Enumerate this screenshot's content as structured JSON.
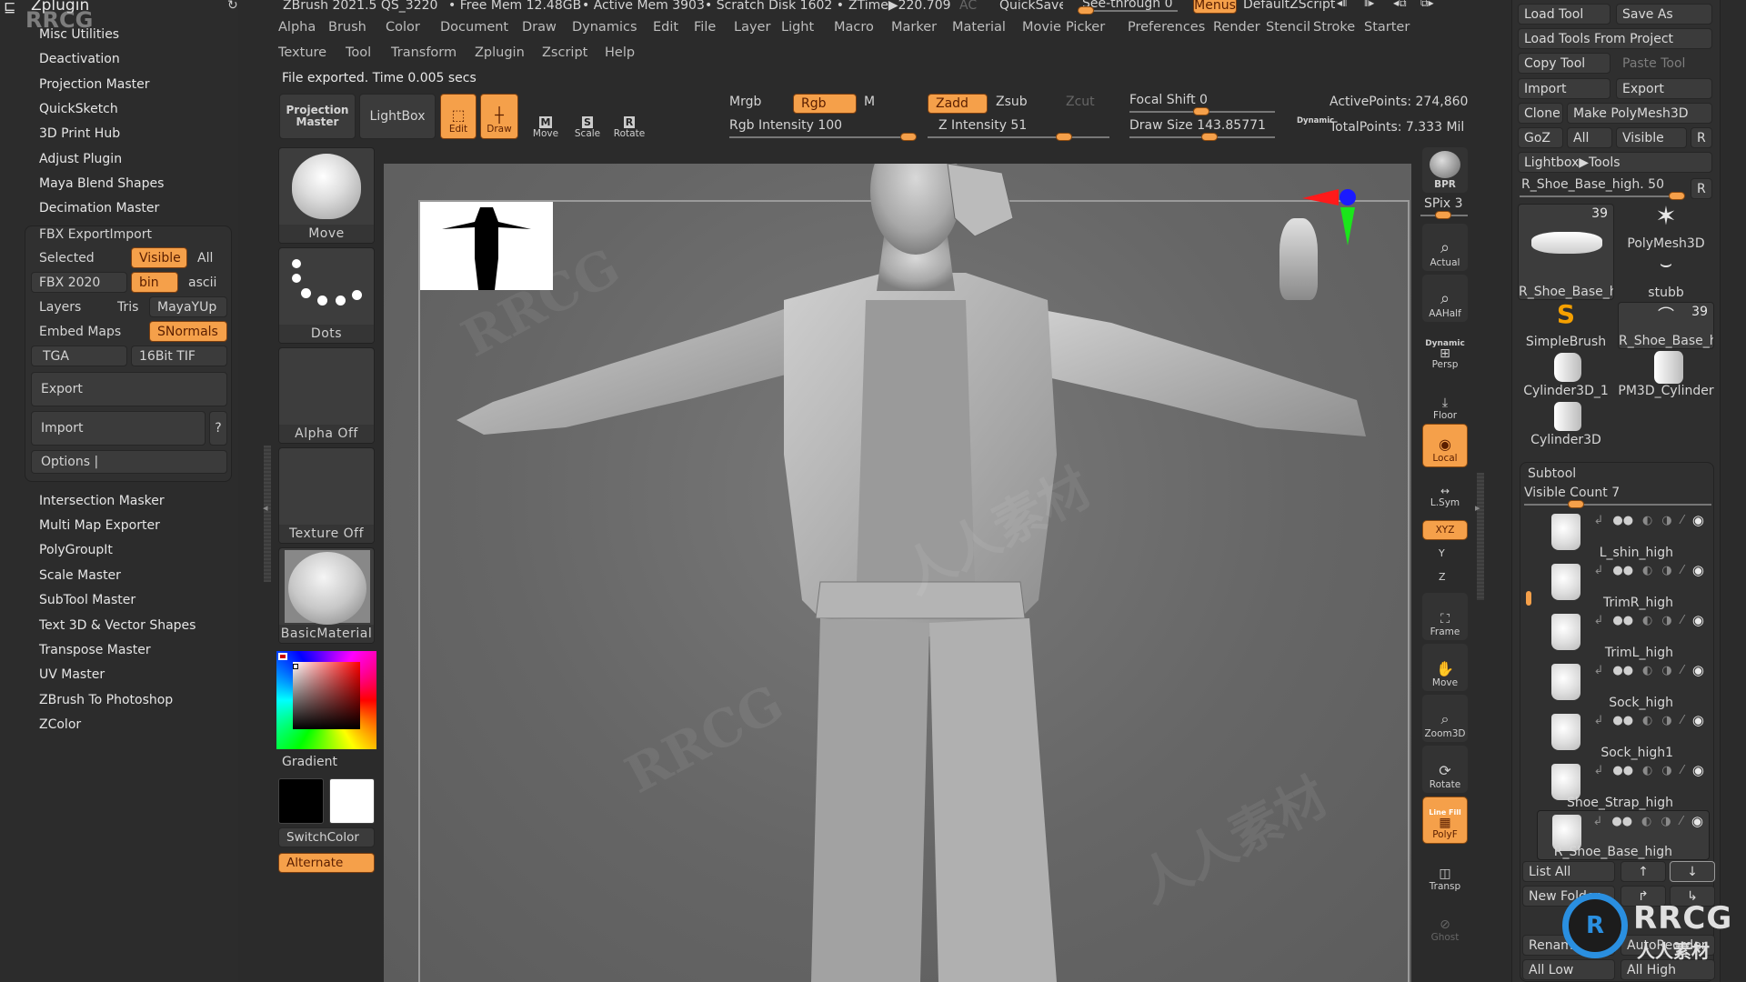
{
  "title_bar": {
    "app_info": "ZBrush 2021.5 QS_3220",
    "free_mem": "• Free Mem 12.48GB",
    "active_mem": "• Active Mem 3903",
    "scratch_disk": "• Scratch Disk 1602 •",
    "ztime": "ZTime▶220.709",
    "ac": "AC",
    "quicksave": "QuickSave",
    "see_through": "See-through  0",
    "see_through_value": 0,
    "menus": "Menus",
    "default_zscript": "DefaultZScript"
  },
  "menu_bar": {
    "row1": [
      "Alpha",
      "Brush",
      "Color",
      "Document",
      "Draw",
      "Dynamics",
      "Edit",
      "File",
      "Layer",
      "Light",
      "Macro",
      "Marker",
      "Material",
      "Movie",
      "Picker",
      "Preferences",
      "Render",
      "Stencil",
      "Stroke",
      "Starter"
    ],
    "row2": [
      "Texture",
      "Tool",
      "Transform",
      "Zplugin",
      "Zscript",
      "Help"
    ]
  },
  "status_message": "File exported. Time 0.005 secs",
  "zplugin": {
    "header": "Zplugin",
    "items_top": [
      "Misc Utilities",
      "Deactivation",
      "Projection Master",
      "QuickSketch",
      "3D Print Hub",
      "Adjust Plugin",
      "Maya Blend Shapes",
      "Decimation Master"
    ],
    "fbx": {
      "title": "FBX ExportImport",
      "selected": "Selected",
      "visible": "Visible",
      "all": "All",
      "fbx_version": "FBX 2020",
      "bin": "bin",
      "ascii": "ascii",
      "layers": "Layers",
      "tris": "Tris",
      "mayayup": "MayaYUp",
      "embed_maps": "Embed Maps",
      "snormals": "SNormals",
      "tga": "TGA",
      "tif": "16Bit TIF",
      "export": "Export",
      "import": "Import",
      "help": "?",
      "options": "Options |"
    },
    "items_bottom": [
      "Intersection Masker",
      "Multi Map Exporter",
      "PolyGroupIt",
      "Scale Master",
      "SubTool Master",
      "Text 3D & Vector Shapes",
      "Transpose Master",
      "UV Master",
      "ZBrush To Photoshop",
      "ZColor"
    ]
  },
  "toolbar": {
    "projection_master": "Projection Master",
    "lightbox": "LightBox",
    "edit": "Edit",
    "draw": "Draw",
    "move": "Move",
    "scale": "Scale",
    "rotate": "Rotate",
    "mrgb": "Mrgb",
    "rgb": "Rgb",
    "m": "M",
    "rgb_intensity": "Rgb Intensity 100",
    "rgb_intensity_value": 100,
    "zadd": "Zadd",
    "zsub": "Zsub",
    "zcut": "Zcut",
    "z_intensity": "Z Intensity 51",
    "z_intensity_value": 51,
    "focal_shift": "Focal Shift 0",
    "focal_shift_value": 0,
    "draw_size": "Draw Size 143.85771",
    "draw_size_value": 143.85771,
    "dynamic": "Dynamic",
    "active_points": "ActivePoints: 274,860",
    "total_points": "TotalPoints: 7.333 Mil"
  },
  "palette": {
    "brush": "Move",
    "stroke": "Dots",
    "alpha": "Alpha Off",
    "texture": "Texture Off",
    "material": "BasicMaterial",
    "gradient": "Gradient",
    "switch_color": "SwitchColor",
    "alternate": "Alternate",
    "main_color": "#000000",
    "secondary_color": "#ffffff"
  },
  "right_shelf": {
    "bpr": "BPR",
    "spix": "SPix 3",
    "spix_value": 3,
    "actual": "Actual",
    "aahalf": "AAHalf",
    "dynamic": "Dynamic",
    "persp": "Persp",
    "floor": "Floor",
    "local": "Local",
    "lsym": "L.Sym",
    "xyz": "XYZ",
    "y": "Y",
    "z": "Z",
    "frame": "Frame",
    "move": "Move",
    "zoom3d": "Zoom3D",
    "rotate": "Rotate",
    "linefill": "Line Fill",
    "polyf": "PolyF",
    "transp": "Transp",
    "ghost": "Ghost"
  },
  "tool_panel": {
    "load_tool": "Load Tool",
    "save_as": "Save As",
    "load_from_project": "Load Tools From Project",
    "copy_tool": "Copy Tool",
    "paste_tool": "Paste Tool",
    "import": "Import",
    "export": "Export",
    "clone": "Clone",
    "make_polymesh": "Make PolyMesh3D",
    "goz": "GoZ",
    "all": "All",
    "visible": "Visible",
    "r": "R",
    "lightbox_tools": "Lightbox▶Tools",
    "current_tool": "R_Shoe_Base_high. 50",
    "current_tool_value": 50,
    "tools": [
      {
        "name": "R_Shoe_Base_h",
        "count": "39"
      },
      {
        "name": "PolyMesh3D",
        "count": ""
      },
      {
        "name": "stubb",
        "count": ""
      },
      {
        "name": "SimpleBrush",
        "count": ""
      },
      {
        "name": "R_Shoe_Base_h",
        "count": "39"
      },
      {
        "name": "Cylinder3D_1",
        "count": ""
      },
      {
        "name": "PM3D_Cylinder",
        "count": ""
      },
      {
        "name": "Cylinder3D",
        "count": ""
      }
    ]
  },
  "subtool": {
    "title": "Subtool",
    "visible_count": "Visible Count 7",
    "visible_count_value": 7,
    "items": [
      "L_shin_high",
      "TrimR_high",
      "TrimL_high",
      "Sock_high",
      "Sock_high1",
      "Shoe_Strap_high",
      "R_Shoe_Base_high"
    ],
    "list_all": "List All",
    "new_folder": "New Folder",
    "rename": "Rename",
    "autoreorder": "AutoReorder",
    "all_low": "All Low",
    "all_high": "All High"
  },
  "watermark": {
    "logo": "RRCG",
    "sub": "人人素材"
  },
  "colors": {
    "accent": "#f5a04a",
    "panel": "#2b2b2b",
    "button": "#3b3b3b"
  }
}
